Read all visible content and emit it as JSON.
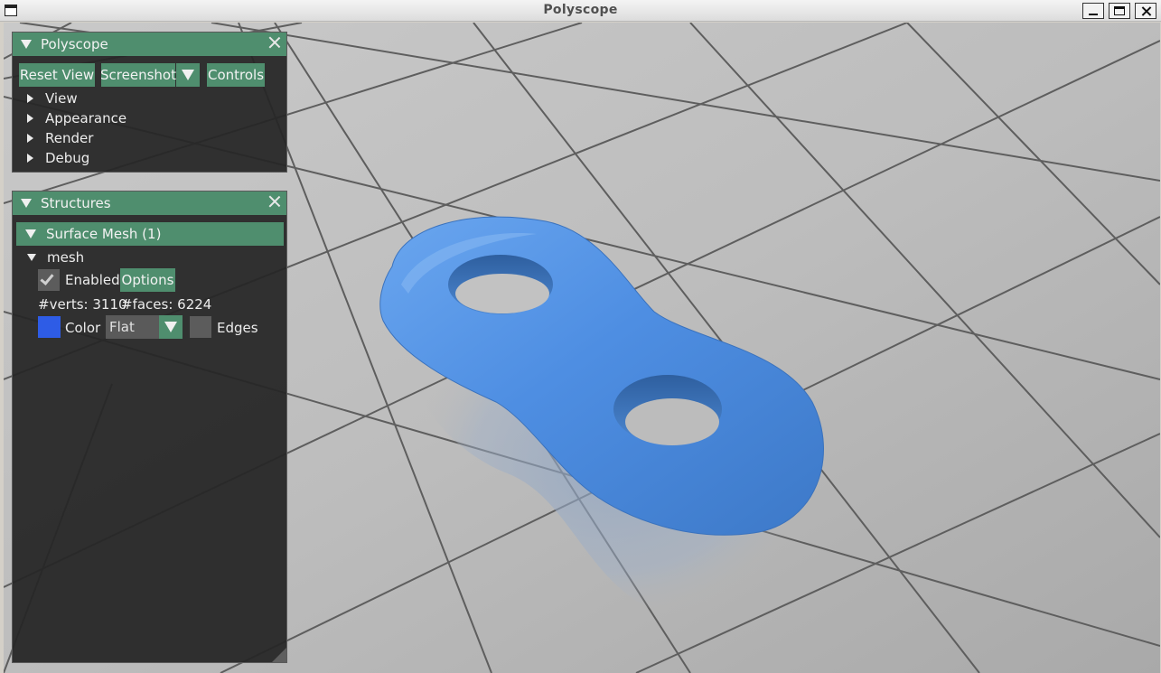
{
  "window": {
    "title": "Polyscope"
  },
  "polyscope_panel": {
    "title": "Polyscope",
    "buttons": {
      "reset_view": "Reset View",
      "screenshot": "Screenshot",
      "controls": "Controls"
    },
    "tree_items": [
      "View",
      "Appearance",
      "Render",
      "Debug"
    ]
  },
  "structures_panel": {
    "title": "Structures",
    "group_header": "Surface Mesh (1)",
    "mesh": {
      "name": "mesh",
      "enabled_label": "Enabled",
      "enabled": true,
      "options_label": "Options",
      "verts_label": "#verts: 3110",
      "faces_label": "#faces: 6224",
      "color_label": "Color",
      "color_value": "#2e5ce6",
      "shading_selected": "Flat",
      "edges_label": "Edges",
      "edges_enabled": false
    }
  },
  "colors": {
    "accent": "#4f8e6e",
    "panel_bg": "#262626",
    "mesh_color": "#4a8ee0"
  },
  "icons": [
    "window-menu-icon",
    "minimize-icon",
    "maximize-icon",
    "close-icon",
    "collapse-triangle-icon",
    "expand-triangle-icon",
    "dropdown-arrow-icon",
    "checkmark-icon"
  ]
}
